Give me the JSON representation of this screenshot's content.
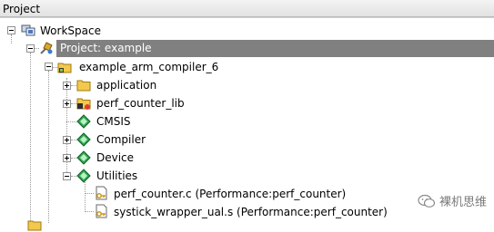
{
  "panel": {
    "title": "Project"
  },
  "tree": {
    "workspace": {
      "label": "WorkSpace",
      "icon": "workspace-icon"
    },
    "project": {
      "label": "Project: example",
      "icon": "project-settings-icon"
    },
    "target": {
      "label": "example_arm_compiler_6",
      "icon": "target-folder-icon"
    },
    "groups": [
      {
        "label": "application",
        "icon": "folder-icon",
        "expanded": false
      },
      {
        "label": "perf_counter_lib",
        "icon": "library-folder-icon",
        "expanded": false
      },
      {
        "label": "CMSIS",
        "icon": "component-diamond-icon",
        "expanded": null
      },
      {
        "label": "Compiler",
        "icon": "component-diamond-icon",
        "expanded": false
      },
      {
        "label": "Device",
        "icon": "component-diamond-icon",
        "expanded": false
      },
      {
        "label": "Utilities",
        "icon": "component-diamond-icon",
        "expanded": true
      }
    ],
    "files": [
      {
        "label": "perf_counter.c (Performance:perf_counter)",
        "icon": "source-file-key-icon"
      },
      {
        "label": "systick_wrapper_ual.s (Performance:perf_counter)",
        "icon": "source-file-key-icon"
      }
    ]
  },
  "watermark": {
    "label": "裸机思维",
    "icon": "wechat-icon"
  },
  "colors": {
    "selection": "#808080",
    "component_green": "#2fa84f",
    "folder_yellow": "#f2c94c"
  }
}
